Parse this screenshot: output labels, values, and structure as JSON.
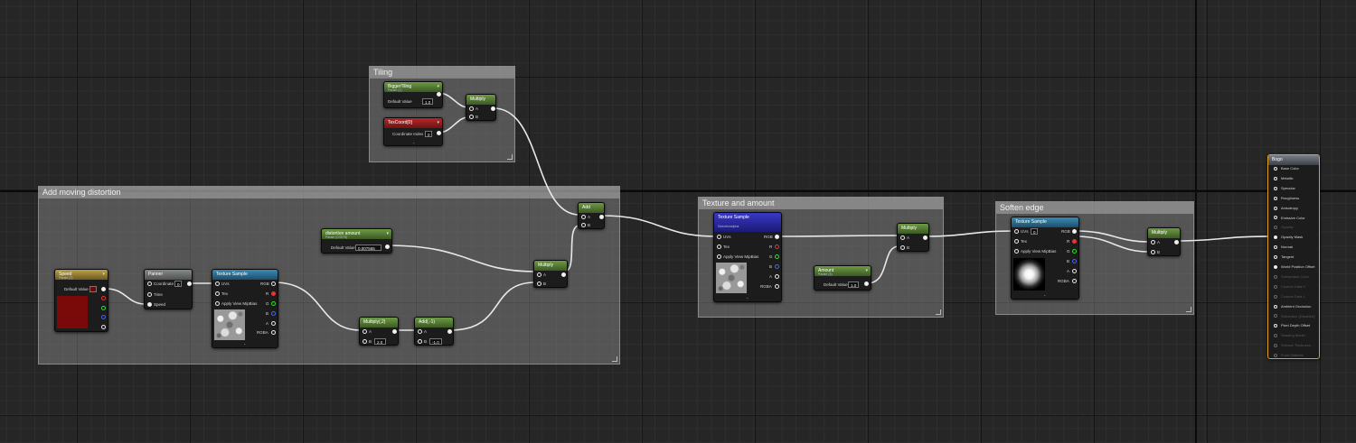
{
  "comments": {
    "tiling": "Tiling",
    "moving_distortion": "Add moving distortion",
    "texture_amount": "Texture and amount",
    "soften_edge": "Soften edge"
  },
  "nodes": {
    "bigger_tiling": {
      "title": "BiggerTiling",
      "subtitle": "Param (1)",
      "default_label": "Default Value",
      "default_value": "1.0"
    },
    "tex_coord": {
      "title": "TexCoord[0]",
      "coord_label": "Coordinate Index",
      "coord_value": "0"
    },
    "multiply_tiling": {
      "title": "Multiply",
      "a": "A",
      "b": "B"
    },
    "add_main": {
      "title": "Add",
      "a": "A",
      "b": "B"
    },
    "speed": {
      "title": "Speed",
      "subtitle": "Param (1)",
      "default_label": "Default Value"
    },
    "panner": {
      "title": "Panner",
      "coordinate": "Coordinate",
      "coordinate_value": "0",
      "time": "Time",
      "speed": "Speed"
    },
    "texture_sample_1": {
      "title": "Texture Sample",
      "uvs": "UVs",
      "tex": "Tex",
      "apply_view": "Apply View MipBias",
      "rgb": "RGB",
      "r": "R",
      "g": "G",
      "b": "B",
      "a": "A",
      "rgba": "RGBA"
    },
    "distortion_amount": {
      "title": "distortion amount",
      "subtitle": "Param (0.0075)",
      "default_label": "Default Value",
      "default_value": "0.007565"
    },
    "multiply_distortion": {
      "title": "Multiply",
      "a": "A",
      "b": "B"
    },
    "multiply_2": {
      "title": "Multiply(,2)",
      "a": "A",
      "b_label": "B",
      "b_value": "2.0"
    },
    "add_neg1": {
      "title": "Add(,-1)",
      "a": "A",
      "b_label": "B",
      "b_value": "-1.0"
    },
    "texture_sample_2": {
      "title": "Texture Sample",
      "subtitle": "Distortionalpha",
      "uvs": "UVs",
      "tex": "Tex",
      "apply_view": "Apply View MipBias",
      "rgb": "RGB",
      "r": "R",
      "g": "G",
      "b": "B",
      "a": "A",
      "rgba": "RGBA"
    },
    "amount": {
      "title": "Amount",
      "subtitle": "Param (1)",
      "default_label": "Default Value",
      "default_value": "1.0"
    },
    "multiply_amount": {
      "title": "Multiply",
      "a": "A",
      "b": "B"
    },
    "texture_sample_3": {
      "title": "Texture Sample",
      "uvs": "UVs",
      "uvs_value": "0",
      "tex": "Tex",
      "apply_view": "Apply View MipBias",
      "rgb": "RGB",
      "r": "R",
      "g": "G",
      "b": "B",
      "a": "A",
      "rgba": "RGBA"
    },
    "multiply_edge": {
      "title": "Multiply",
      "a": "A",
      "b": "B"
    },
    "result": {
      "title": "Bogo",
      "inputs": [
        {
          "label": "Base Color",
          "enabled": true
        },
        {
          "label": "Metallic",
          "enabled": true
        },
        {
          "label": "Specular",
          "enabled": true
        },
        {
          "label": "Roughness",
          "enabled": true
        },
        {
          "label": "Anisotropy",
          "enabled": true
        },
        {
          "label": "Emissive Color",
          "enabled": true
        },
        {
          "label": "Opacity",
          "enabled": false
        },
        {
          "label": "Opacity Mask",
          "enabled": true
        },
        {
          "label": "Normal",
          "enabled": true
        },
        {
          "label": "Tangent",
          "enabled": true
        },
        {
          "label": "World Position Offset",
          "enabled": true
        },
        {
          "label": "Subsurface Color",
          "enabled": false
        },
        {
          "label": "Custom Data 0",
          "enabled": false
        },
        {
          "label": "Custom Data 1",
          "enabled": false
        },
        {
          "label": "Ambient Occlusion",
          "enabled": true
        },
        {
          "label": "Refraction (Disabled)",
          "enabled": false
        },
        {
          "label": "Pixel Depth Offset",
          "enabled": true
        },
        {
          "label": "Shading Model",
          "enabled": false
        },
        {
          "label": "Surface Thickness",
          "enabled": false
        },
        {
          "label": "Front Material",
          "enabled": false
        }
      ]
    }
  }
}
